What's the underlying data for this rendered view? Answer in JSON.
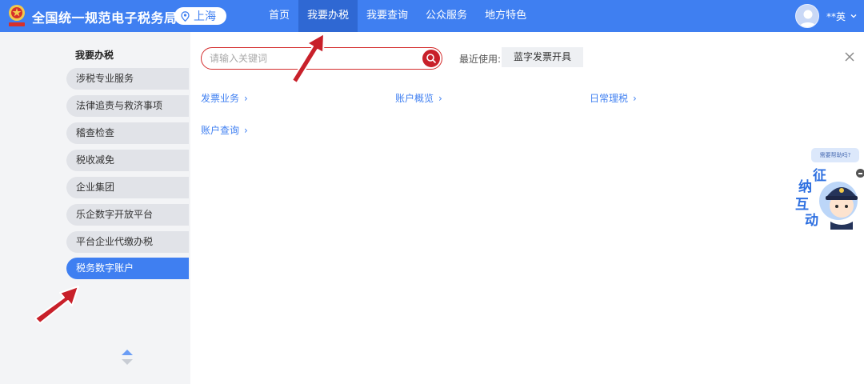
{
  "header": {
    "site_title": "全国统一规范电子税务局",
    "region": "上海",
    "nav": [
      {
        "label": "首页",
        "active": false
      },
      {
        "label": "我要办税",
        "active": true
      },
      {
        "label": "我要查询",
        "active": false
      },
      {
        "label": "公众服务",
        "active": false
      },
      {
        "label": "地方特色",
        "active": false
      }
    ],
    "user_name": "**英"
  },
  "sidebar": {
    "title": "我要办税",
    "items": [
      {
        "label": "涉税专业服务",
        "active": false
      },
      {
        "label": "法律追责与救济事项",
        "active": false
      },
      {
        "label": "稽查检查",
        "active": false
      },
      {
        "label": "税收减免",
        "active": false
      },
      {
        "label": "企业集团",
        "active": false
      },
      {
        "label": "乐企数字开放平台",
        "active": false
      },
      {
        "label": "平台企业代缴办税",
        "active": false
      },
      {
        "label": "税务数字账户",
        "active": true
      }
    ]
  },
  "search": {
    "placeholder": "请输入关键词",
    "value": ""
  },
  "recent": {
    "label": "最近使用:",
    "items": [
      "蓝字发票开具"
    ]
  },
  "categories": [
    {
      "label": "发票业务",
      "chevron": "›"
    },
    {
      "label": "账户概览",
      "chevron": "›"
    },
    {
      "label": "日常理税",
      "chevron": "›"
    },
    {
      "label": "账户查询",
      "chevron": "›"
    }
  ],
  "assistant": {
    "bubble": "需要帮助吗?",
    "chars": [
      "征",
      "纳",
      "互",
      "动"
    ]
  },
  "colors": {
    "brand_blue": "#3f7ff1",
    "nav_active": "#2f68d3",
    "search_red": "#c8202a",
    "annotation_red": "#c8202a"
  },
  "icons": [
    "emblem-logo",
    "location-pin-icon",
    "user-avatar-icon",
    "chevron-down-icon",
    "search-icon",
    "close-icon",
    "scroll-arrows-icon",
    "minimize-icon"
  ]
}
